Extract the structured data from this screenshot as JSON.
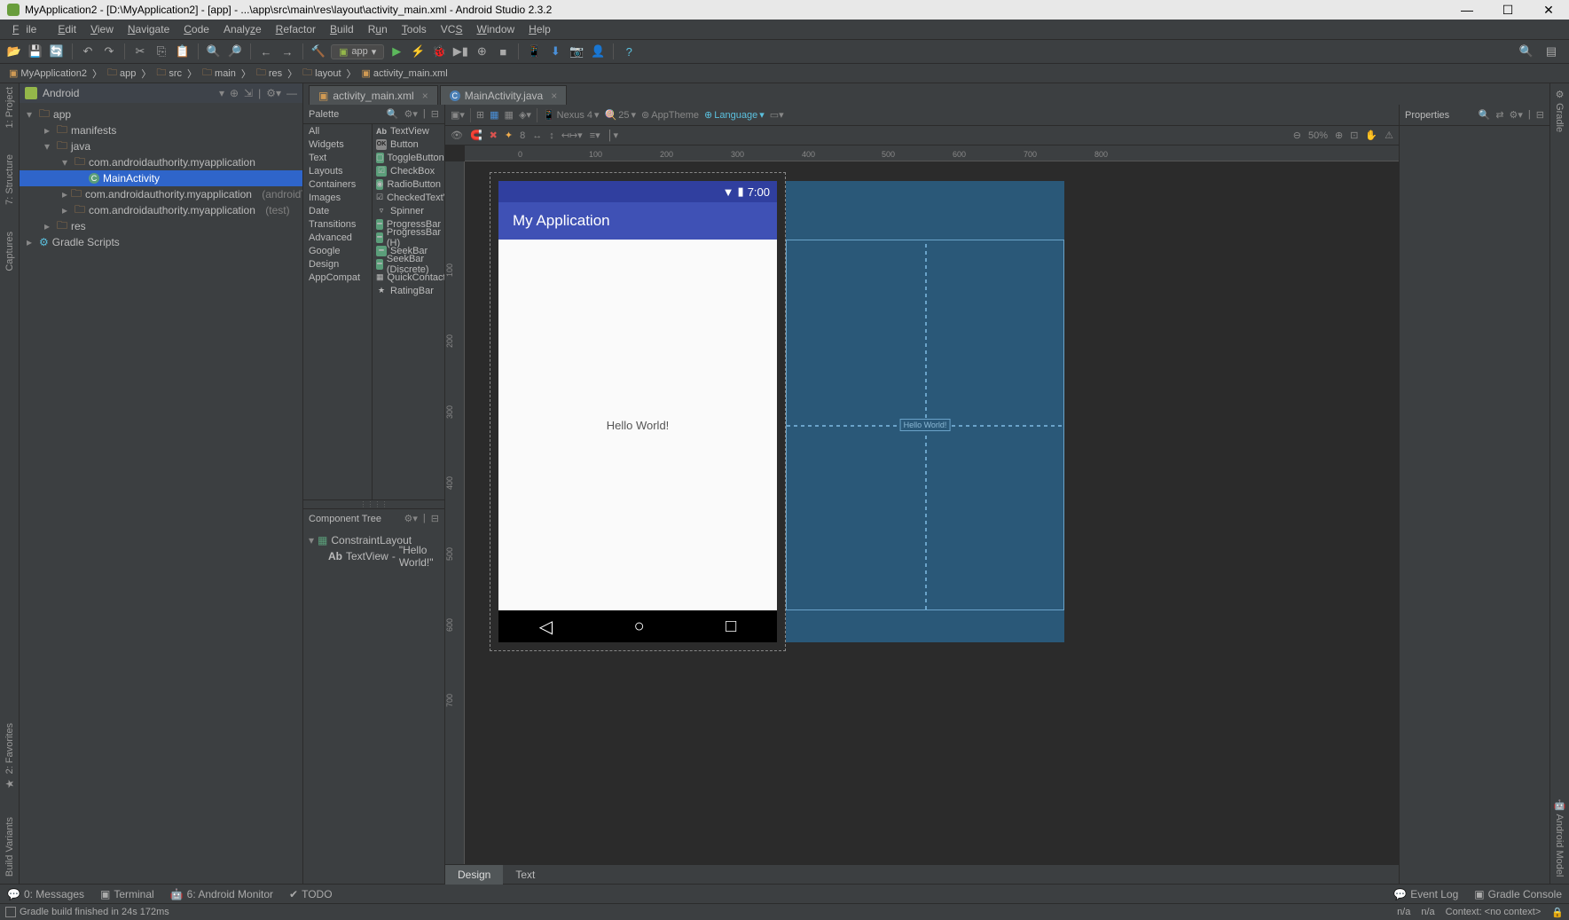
{
  "title": "MyApplication2 - [D:\\MyApplication2] - [app] - ...\\app\\src\\main\\res\\layout\\activity_main.xml - Android Studio 2.3.2",
  "menu": [
    "File",
    "Edit",
    "View",
    "Navigate",
    "Code",
    "Analyze",
    "Refactor",
    "Build",
    "Run",
    "Tools",
    "VCS",
    "Window",
    "Help"
  ],
  "breadcrumb": [
    {
      "icon": "project",
      "label": "MyApplication2"
    },
    {
      "icon": "folder",
      "label": "app"
    },
    {
      "icon": "folder",
      "label": "src"
    },
    {
      "icon": "folder",
      "label": "main"
    },
    {
      "icon": "folder",
      "label": "res"
    },
    {
      "icon": "folder",
      "label": "layout"
    },
    {
      "icon": "file",
      "label": "activity_main.xml"
    }
  ],
  "app_config": "app",
  "left_rail": [
    "1: Project",
    "7: Structure",
    "Captures",
    "2: Favorites",
    "Build Variants"
  ],
  "right_rail": [
    "Gradle",
    "Android Model"
  ],
  "project_header": "Android",
  "project_tree": {
    "app": "app",
    "manifests": "manifests",
    "java": "java",
    "pkg1": "com.androidauthority.myapplication",
    "main_activity": "MainActivity",
    "pkg2": "com.androidauthority.myapplication",
    "pkg2_suffix": "(androidTest)",
    "pkg3": "com.androidauthority.myapplication",
    "pkg3_suffix": "(test)",
    "res": "res",
    "gradle": "Gradle Scripts"
  },
  "tabs": [
    {
      "label": "activity_main.xml",
      "type": "xml",
      "active": true
    },
    {
      "label": "MainActivity.java",
      "type": "java",
      "active": false
    }
  ],
  "palette": {
    "title": "Palette",
    "categories": [
      "All",
      "Widgets",
      "Text",
      "Layouts",
      "Containers",
      "Images",
      "Date",
      "Transitions",
      "Advanced",
      "Google",
      "Design",
      "AppCompat"
    ],
    "widgets": [
      {
        "icon": "Ab",
        "label": "TextView",
        "bg": ""
      },
      {
        "icon": "OK",
        "label": "Button",
        "bg": "#888"
      },
      {
        "icon": "□",
        "label": "ToggleButton",
        "bg": "#5b9e7a"
      },
      {
        "icon": "☑",
        "label": "CheckBox",
        "bg": "#5b9e7a"
      },
      {
        "icon": "◉",
        "label": "RadioButton",
        "bg": "#5b9e7a"
      },
      {
        "icon": "☑",
        "label": "CheckedTextView",
        "bg": ""
      },
      {
        "icon": "▾",
        "label": "Spinner",
        "bg": ""
      },
      {
        "icon": "━",
        "label": "ProgressBar",
        "bg": "#5b9e7a"
      },
      {
        "icon": "━",
        "label": "ProgressBar (H)",
        "bg": "#5b9e7a"
      },
      {
        "icon": "━",
        "label": "SeekBar",
        "bg": "#5b9e7a"
      },
      {
        "icon": "━",
        "label": "SeekBar (Discrete)",
        "bg": "#5b9e7a"
      },
      {
        "icon": "▦",
        "label": "QuickContactBadge",
        "bg": ""
      },
      {
        "icon": "★",
        "label": "RatingBar",
        "bg": ""
      }
    ]
  },
  "component_tree": {
    "title": "Component Tree",
    "root": "ConstraintLayout",
    "child": "TextView",
    "child_val": "\"Hello World!\""
  },
  "canvas_toolbar": {
    "device": "Nexus 4",
    "api": "25",
    "theme": "AppTheme",
    "lang": "Language"
  },
  "canvas_toolbar2": {
    "margin": "8",
    "zoom": "50%"
  },
  "ruler_h": [
    "0",
    "100",
    "200",
    "300",
    "400",
    "500",
    "600",
    "700",
    "800"
  ],
  "ruler_v": [
    "100",
    "200",
    "300",
    "400",
    "500",
    "600",
    "700"
  ],
  "device": {
    "time": "7:00",
    "app_title": "My Application",
    "hello": "Hello World!"
  },
  "blueprint_text": "Hello World!",
  "properties": "Properties",
  "design_tabs": [
    "Design",
    "Text"
  ],
  "bottom_bar": {
    "messages": "0: Messages",
    "terminal": "Terminal",
    "monitor": "6: Android Monitor",
    "todo": "TODO",
    "eventlog": "Event Log",
    "gradle": "Gradle Console"
  },
  "status": "Gradle build finished in 24s 172ms",
  "status_right": {
    "na1": "n/a",
    "na2": "n/a",
    "context": "Context: <no context>"
  }
}
